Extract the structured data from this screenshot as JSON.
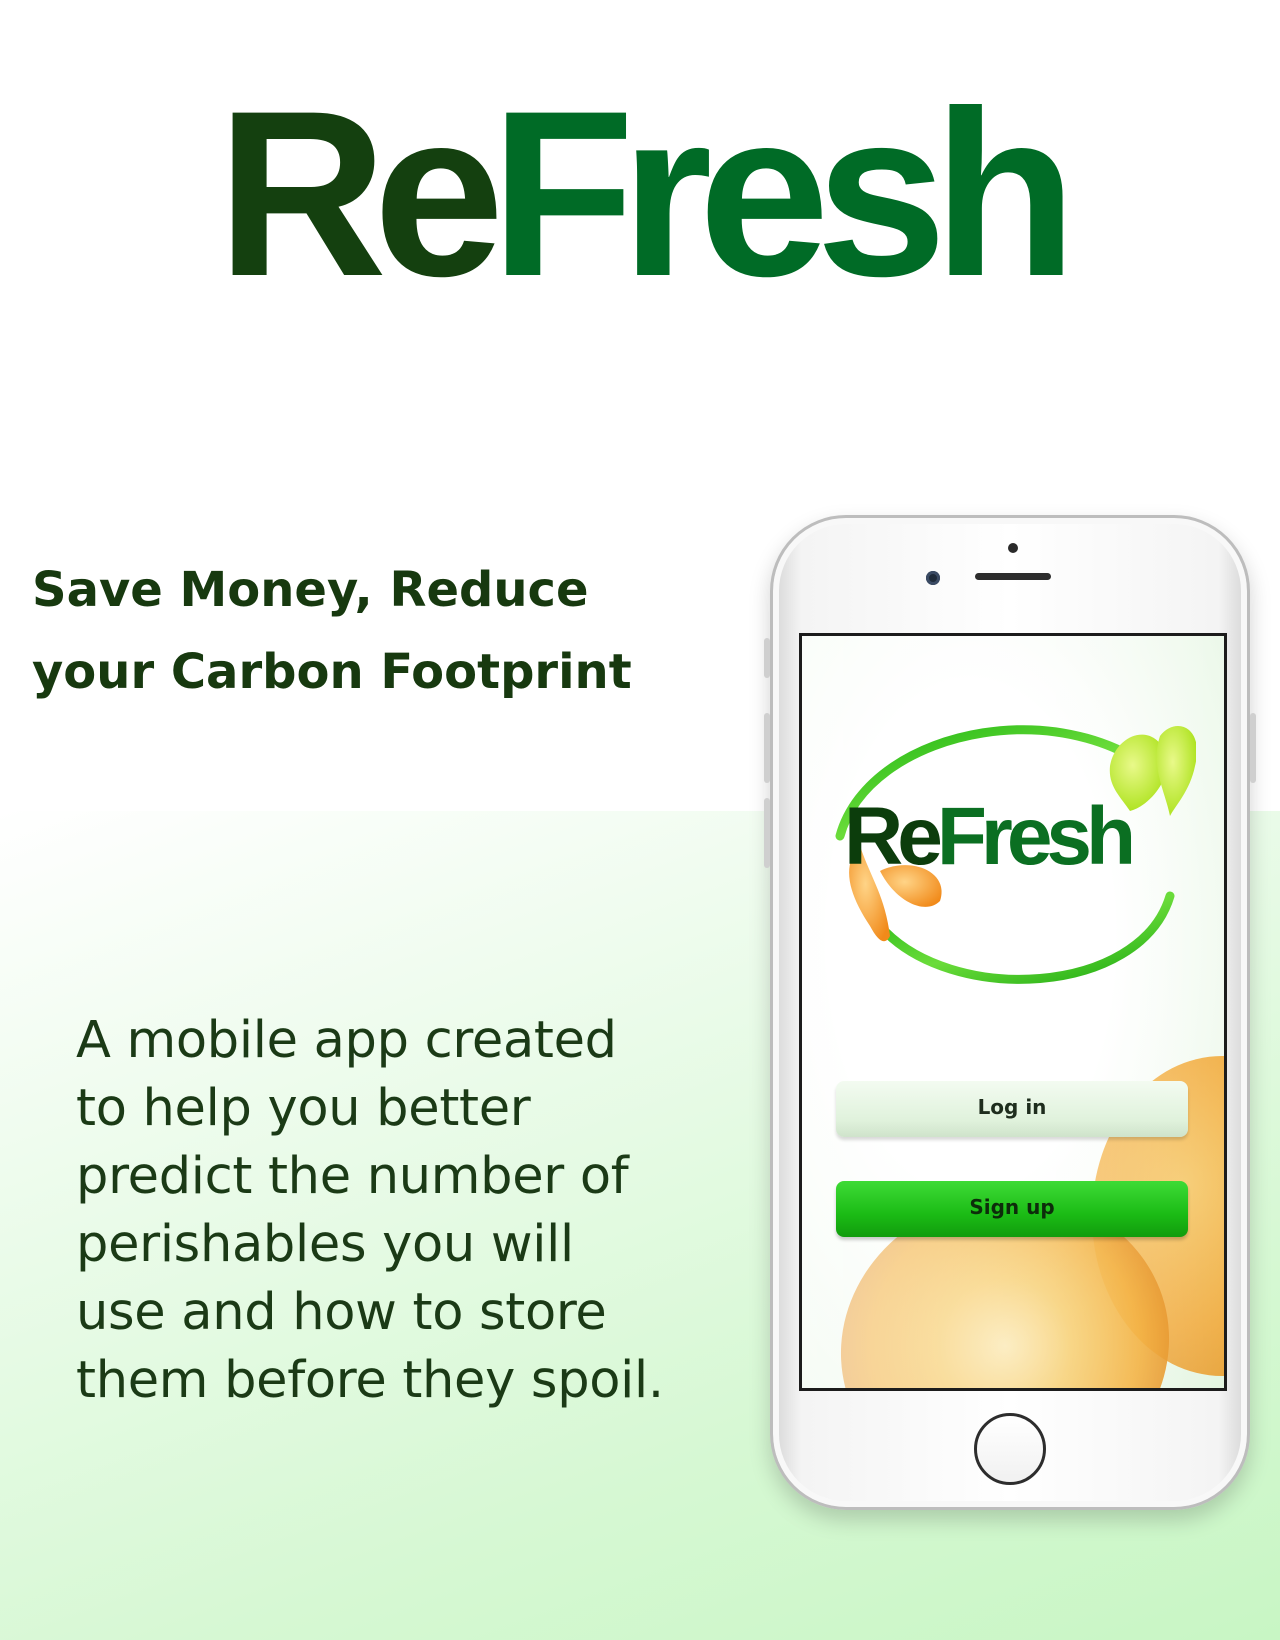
{
  "hero": {
    "title_part1": "Re",
    "title_part2": "Fresh"
  },
  "tagline": "Save Money, Reduce\nyour Carbon Footprint",
  "description": " A mobile app created\nto help you better\npredict the number of\nperishables you will\nuse and how to store\nthem before they spoil.",
  "app_screen": {
    "logo_part1": "Re",
    "logo_part2": "Fresh",
    "login_label": "Log in",
    "signup_label": "Sign up"
  },
  "colors": {
    "dark_green": "#14400f",
    "brand_green": "#006b26",
    "signup_green": "#1bbb15",
    "login_bg": "#e0f2dc"
  }
}
